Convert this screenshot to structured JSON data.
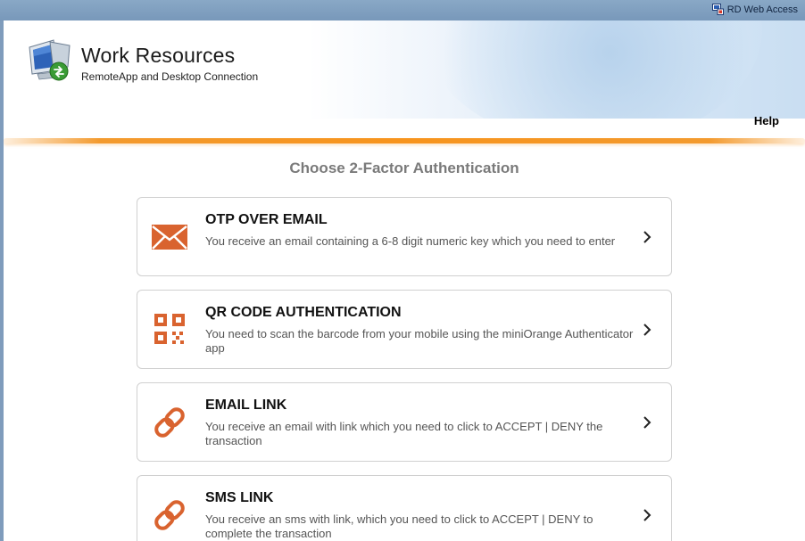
{
  "topbar": {
    "label": "RD Web Access",
    "icon": "rd-web-access-icon"
  },
  "header": {
    "title": "Work Resources",
    "subtitle": "RemoteApp and Desktop Connection",
    "logo_icon": "remote-desktop-logo-icon",
    "help_label": "Help"
  },
  "main": {
    "heading": "Choose 2-Factor Authentication",
    "accent_color": "#d9632f",
    "divider_color": "#f7941d",
    "options": [
      {
        "title": "OTP OVER EMAIL",
        "description": "You receive an email containing a 6-8 digit numeric key which you need to enter",
        "icon": "envelope-icon"
      },
      {
        "title": "QR CODE AUTHENTICATION",
        "description": "You need to scan the barcode from your mobile using the miniOrange Authenticator app",
        "icon": "qr-code-icon"
      },
      {
        "title": "EMAIL LINK",
        "description": "You receive an email with link which you need to click to ACCEPT | DENY the transaction",
        "icon": "link-icon"
      },
      {
        "title": "SMS LINK",
        "description": "You receive an sms with link, which you need to click to ACCEPT | DENY to complete the transaction",
        "icon": "link-icon"
      }
    ]
  }
}
